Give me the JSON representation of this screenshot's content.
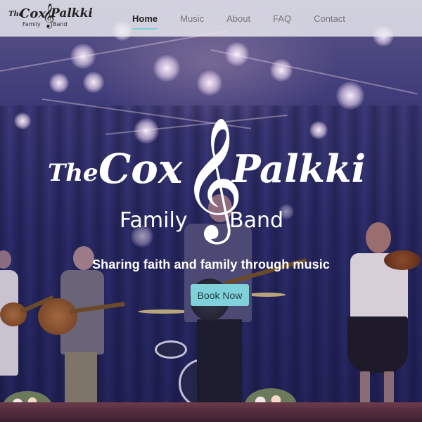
{
  "nav": {
    "logo": {
      "the": "The",
      "cox": "Cox",
      "palkki": "Palkki",
      "family": "Family",
      "band": "Band",
      "clef": "𝄞"
    },
    "links": [
      {
        "label": "Home"
      },
      {
        "label": "Music"
      },
      {
        "label": "About"
      },
      {
        "label": "FAQ"
      },
      {
        "label": "Contact"
      }
    ],
    "active": "Home"
  },
  "hero": {
    "brand": {
      "the": "The",
      "cox": "Cox",
      "palkki": "Palkki",
      "family": "Family",
      "band": "Band",
      "clef": "𝄞"
    },
    "tagline": "Sharing faith and family through music",
    "cta_label": "Book Now",
    "background": "band-on-stage-photo"
  },
  "colors": {
    "accent": "#7fd3d8",
    "nav_bg": "#ebebf0",
    "overlay": "#2c2c6a"
  }
}
